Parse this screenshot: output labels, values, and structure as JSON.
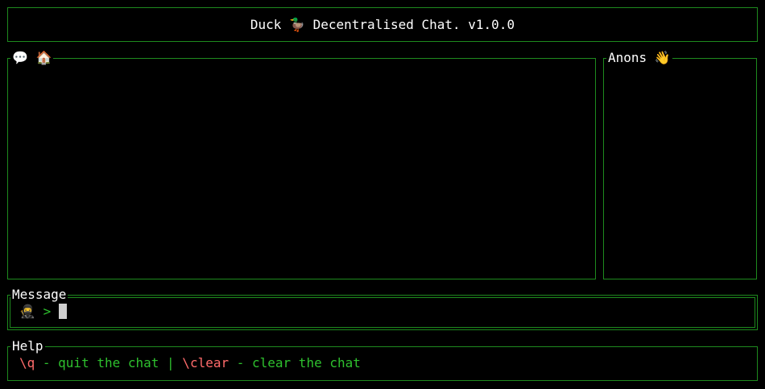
{
  "header": {
    "title": "Duck 🦆 Decentralised Chat. v1.0.0"
  },
  "chat_panel": {
    "title": "💬 🏠"
  },
  "anons_panel": {
    "title": "Anons 👋"
  },
  "message_panel": {
    "title": "Message",
    "user_avatar": "🥷",
    "prompt_symbol": ">",
    "input_value": ""
  },
  "help_panel": {
    "title": "Help",
    "quit_command": "\\q",
    "quit_desc": " - quit the chat ",
    "separator": "|",
    "clear_command": " \\clear",
    "clear_desc": " - clear the chat"
  },
  "colors": {
    "border": "#1e8a1e",
    "command": "#ff6b6b",
    "description": "#2ec02e",
    "background": "#000000"
  }
}
